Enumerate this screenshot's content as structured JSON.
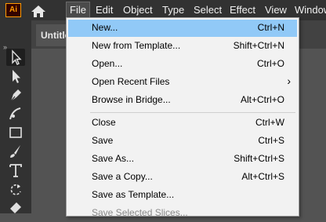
{
  "app": {
    "logo_text": "Ai",
    "brand_color": "#ff9a00"
  },
  "menubar": {
    "items": [
      "File",
      "Edit",
      "Object",
      "Type",
      "Select",
      "Effect",
      "View",
      "Window"
    ],
    "active": "File"
  },
  "document_tab": {
    "title": "Untitled"
  },
  "file_menu": {
    "highlight_color": "#91c9f7",
    "items": [
      {
        "label": "New...",
        "shortcut": "Ctrl+N"
      },
      {
        "label": "New from Template...",
        "shortcut": "Shift+Ctrl+N"
      },
      {
        "label": "Open...",
        "shortcut": "Ctrl+O"
      },
      {
        "label": "Open Recent Files",
        "shortcut": "",
        "submenu": true
      },
      {
        "label": "Browse in Bridge...",
        "shortcut": "Alt+Ctrl+O"
      },
      {
        "label": "Close",
        "shortcut": "Ctrl+W"
      },
      {
        "label": "Save",
        "shortcut": "Ctrl+S"
      },
      {
        "label": "Save As...",
        "shortcut": "Shift+Ctrl+S"
      },
      {
        "label": "Save a Copy...",
        "shortcut": "Alt+Ctrl+S"
      },
      {
        "label": "Save as Template...",
        "shortcut": ""
      },
      {
        "label": "Save Selected Slices...",
        "shortcut": "",
        "disabled": true
      }
    ]
  },
  "tools": [
    "selection-tool",
    "direct-selection-tool",
    "pen-tool",
    "curvature-tool",
    "rectangle-tool",
    "paintbrush-tool",
    "type-tool",
    "rotate-tool",
    "eraser-tool"
  ]
}
